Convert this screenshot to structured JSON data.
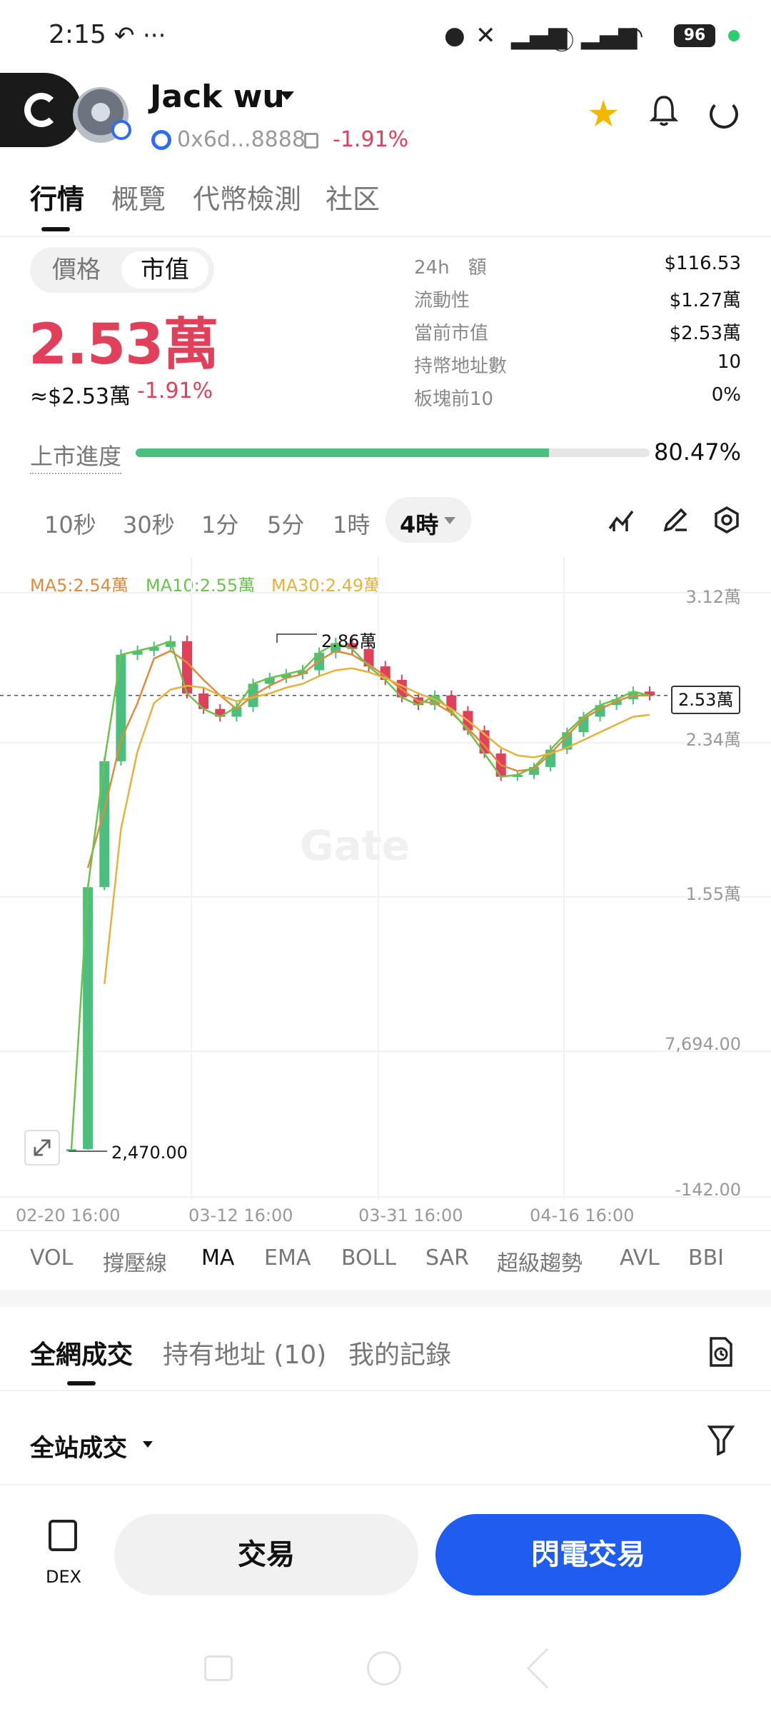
{
  "status_bar": {
    "time": "2:15",
    "battery": "96"
  },
  "header": {
    "token_name": "Jack wu",
    "address": "0x6d...8888",
    "change": "-1.91%",
    "icons": [
      "gate-logo-icon",
      "star-icon",
      "bell-icon",
      "share-icon"
    ]
  },
  "tabs": [
    "行情",
    "概覽",
    "代幣檢測",
    "社区"
  ],
  "price_panel": {
    "toggle": [
      "價格",
      "市值"
    ],
    "main_value": "2.53萬",
    "usd_value": "≈$2.53萬",
    "usd_change": "-1.91%"
  },
  "stats": [
    {
      "label": "24h　額",
      "value": "$116.53"
    },
    {
      "label": "流動性",
      "value": "$1.27萬"
    },
    {
      "label": "當前市值",
      "value": "$2.53萬"
    },
    {
      "label": "持幣地址數",
      "value": "10"
    },
    {
      "label": "板塊前10",
      "value": "0%"
    }
  ],
  "progress": {
    "label": "上市進度",
    "value_text": "80.47%",
    "fraction": 0.8047,
    "color": "#4cbf7f"
  },
  "timeframes": [
    "10秒",
    "30秒",
    "1分",
    "5分",
    "1時",
    "4時"
  ],
  "chart_data": {
    "type": "line",
    "ma_legend": [
      {
        "name": "MA5:2.54萬",
        "color": "#e08a3c"
      },
      {
        "name": "MA10:2.55萬",
        "color": "#6cc24a"
      },
      {
        "name": "MA30:2.49萬",
        "color": "#e6b23a"
      }
    ],
    "y_tick_labels": [
      "3.12萬",
      "2.34萬",
      "1.55萬",
      "7,694.00",
      "-142.00"
    ],
    "x_tick_labels": [
      "02-20 16:00",
      "03-12 16:00",
      "03-31 16:00",
      "04-16 16:00"
    ],
    "ylim": [
      -142,
      31200
    ],
    "annotations": {
      "high": "2.86萬",
      "low": "2,470.00",
      "current": "2.53萬"
    },
    "close": [
      2470,
      16000,
      22500,
      28000,
      28200,
      28400,
      28700,
      26000,
      25200,
      24800,
      25300,
      26500,
      26800,
      27000,
      27200,
      28100,
      28600,
      28300,
      27400,
      26700,
      25800,
      25400,
      25900,
      25100,
      24100,
      22900,
      21700,
      21800,
      22200,
      23100,
      24000,
      24800,
      25400,
      25700,
      26100,
      25900
    ],
    "ma5": [
      null,
      17000,
      20000,
      23600,
      25500,
      27800,
      28200,
      27600,
      26700,
      25900,
      25200,
      25900,
      26400,
      26800,
      27000,
      27700,
      28200,
      28000,
      27500,
      26900,
      26200,
      25600,
      25500,
      25000,
      24200,
      23300,
      22300,
      22000,
      22100,
      22900,
      23800,
      24700,
      25200,
      25600,
      25900,
      25900
    ],
    "ma30": [
      null,
      null,
      11000,
      19000,
      23000,
      25500,
      26200,
      26400,
      26300,
      25900,
      25600,
      25800,
      26000,
      26300,
      26500,
      26900,
      27200,
      27300,
      27100,
      26800,
      26400,
      26000,
      25700,
      25200,
      24600,
      23900,
      23200,
      22800,
      22700,
      22900,
      23200,
      23600,
      24000,
      24400,
      24800,
      24900
    ],
    "colors": {
      "up": "#4cbf7f",
      "down": "#e0405a"
    }
  },
  "indicators": [
    "VOL",
    "撐壓線",
    "MA",
    "EMA",
    "BOLL",
    "SAR",
    "超級趨勢",
    "AVL",
    "BBI"
  ],
  "trade_tabs": [
    "全網成交",
    "持有地址 (10)",
    "我的記錄"
  ],
  "trade_filter": "全站成交",
  "bottom_bar": {
    "dex_label": "DEX",
    "trade_button": "交易",
    "flash_button": "閃電交易",
    "accent": "#1f5cf0"
  },
  "watermark": "Gate"
}
